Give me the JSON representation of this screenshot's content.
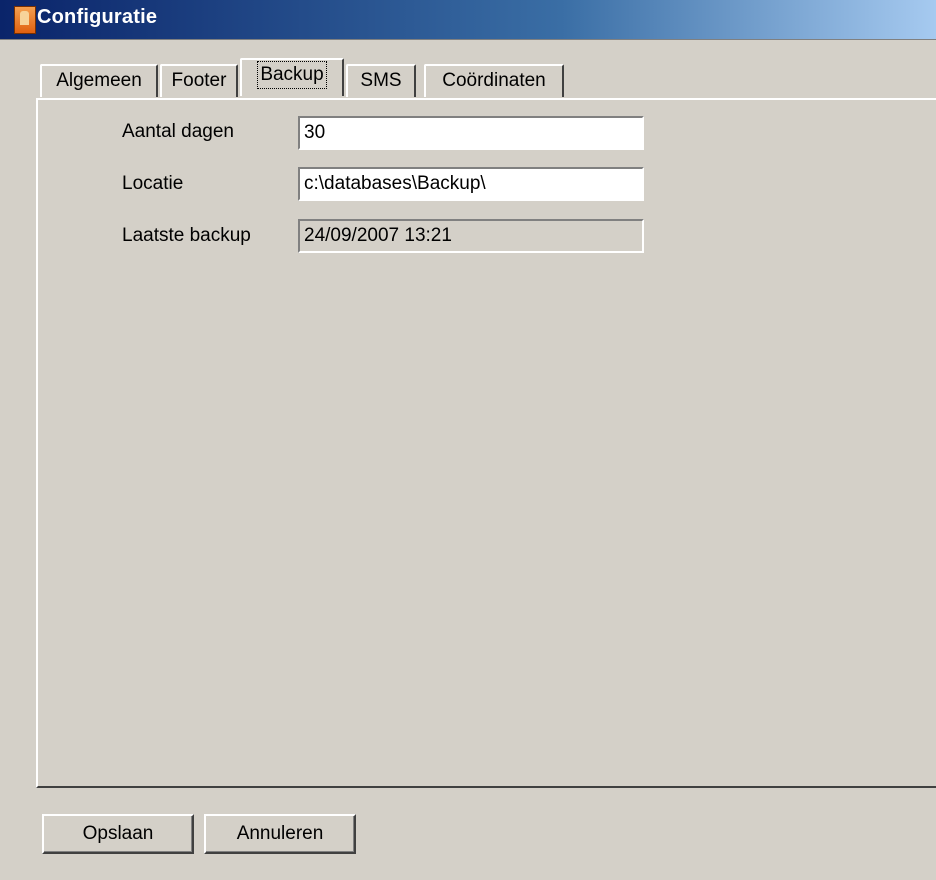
{
  "window": {
    "title": "Configuratie",
    "icon": "app-icon"
  },
  "tabs": [
    {
      "label": "Algemeen",
      "active": false
    },
    {
      "label": "Footer",
      "active": false
    },
    {
      "label": "Backup",
      "active": true
    },
    {
      "label": "SMS",
      "active": false
    },
    {
      "label": "Coördinaten",
      "active": false
    }
  ],
  "backup": {
    "aantal_dagen": {
      "label": "Aantal dagen",
      "value": "30"
    },
    "locatie": {
      "label": "Locatie",
      "value": "c:\\databases\\Backup\\"
    },
    "laatste_backup": {
      "label": "Laatste backup",
      "value": "24/09/2007 13:21"
    }
  },
  "buttons": {
    "save": "Opslaan",
    "cancel": "Annuleren"
  },
  "colors": {
    "face": "#d4d0c8",
    "title_start": "#0a246a",
    "title_end": "#a6caf0"
  }
}
